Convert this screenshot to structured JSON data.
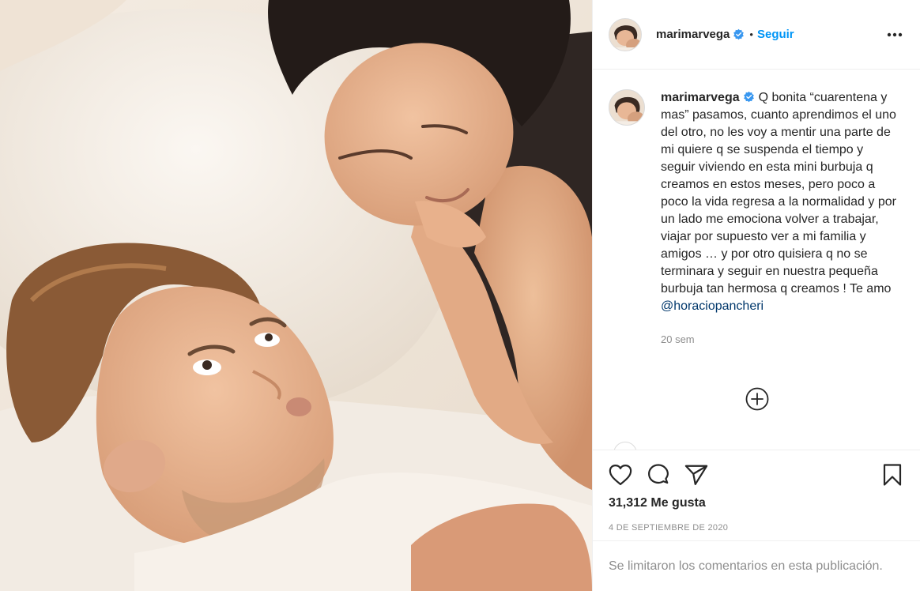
{
  "post": {
    "username": "marimarvega",
    "follow_label": "Seguir",
    "dot": "•",
    "caption": "Q bonita “cuarentena y mas” pasamos, cuanto aprendimos el uno del otro, no les voy a mentir una parte de mi quiere q se suspenda el tiempo y seguir viviendo en esta mini burbuja q creamos en estos meses, pero poco a poco la vida regresa a la normalidad y por un lado me emociona volver a trabajar, viajar por supuesto ver a mi familia y amigos … y por otro quisiera q no se terminara y seguir en nuestra pequeña burbuja tan hermosa q creamos ! Te amo",
    "mention": "@horaciopancheri",
    "time_ago": "20 sem",
    "likes": "31,312 Me gusta",
    "date": "4 DE SEPTIEMBRE DE 2020",
    "comments_limited": "Se limitaron los comentarios en esta publicación."
  },
  "icons": {
    "verified": "verified-badge-icon",
    "more": "more-options-icon",
    "load_more": "plus-circle-icon",
    "like": "heart-icon",
    "comment": "comment-icon",
    "share": "paper-plane-icon",
    "save": "bookmark-icon"
  },
  "colors": {
    "accent": "#0095f6",
    "verified": "#3897f0",
    "muted": "#8e8e8e",
    "text": "#262626",
    "mention": "#00376b"
  }
}
